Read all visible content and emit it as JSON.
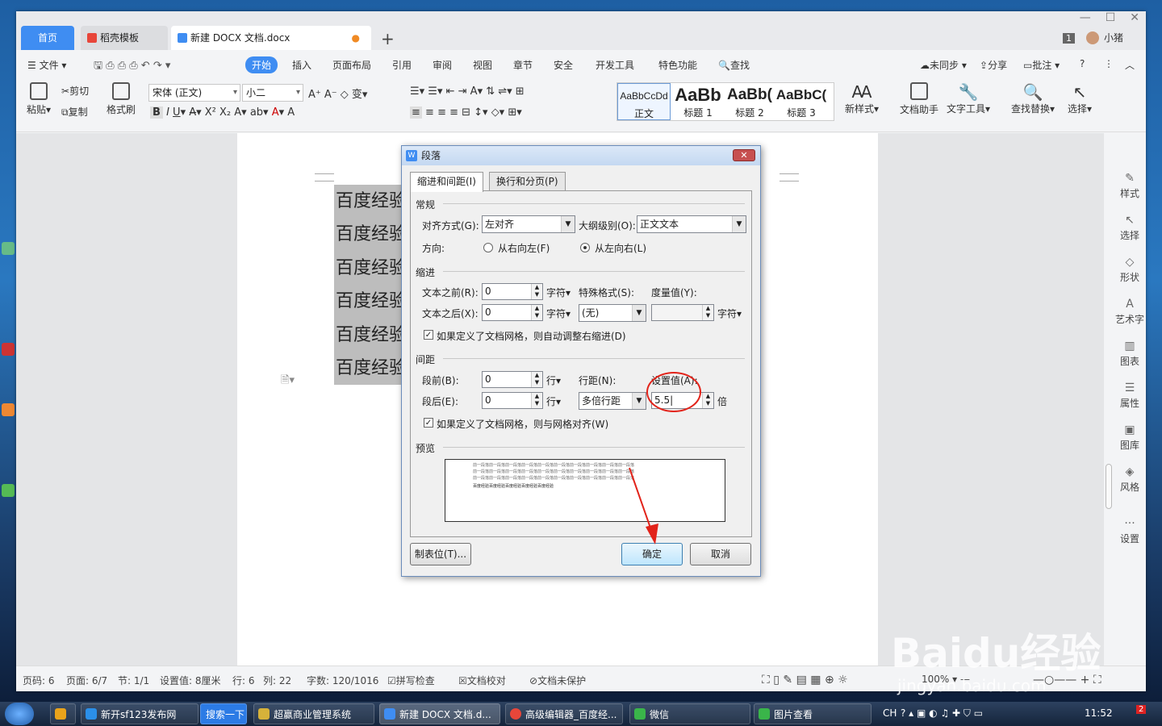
{
  "app": {
    "tabs": {
      "home": "首页",
      "template": "稻壳模板",
      "doc": "新建 DOCX 文档.docx"
    },
    "user": "小猪",
    "badge": "1"
  },
  "menu": {
    "file": "文件",
    "start": "开始",
    "insert": "插入",
    "layout": "页面布局",
    "ref": "引用",
    "review": "审阅",
    "view": "视图",
    "chapter": "章节",
    "security": "安全",
    "dev": "开发工具",
    "special": "特色功能",
    "search": "查找",
    "sync": "未同步",
    "share": "分享",
    "comment": "批注"
  },
  "ribbon": {
    "paste": "粘贴",
    "cut": "剪切",
    "copy": "复制",
    "painter": "格式刷",
    "font": "宋体 (正文)",
    "size": "小二",
    "doc_helper": "文档助手",
    "text_tool": "文字工具",
    "find_replace": "查找替换",
    "select": "选择",
    "new_style": "新样式",
    "styles": [
      {
        "sample": "AaBbCcDd",
        "label": "正文"
      },
      {
        "sample": "AaBb",
        "label": "标题 1"
      },
      {
        "sample": "AaBb(",
        "label": "标题 2"
      },
      {
        "sample": "AaBbC(",
        "label": "标题 3"
      }
    ]
  },
  "doc": {
    "lines": [
      "百度经验",
      "百度经验",
      "百度经验",
      "百度经验",
      "百度经验",
      "百度经验"
    ]
  },
  "right_panel": [
    "样式",
    "选择",
    "形状",
    "艺术字",
    "图表",
    "属性",
    "图库",
    "风格",
    "设置"
  ],
  "status": {
    "page_no": "页码: 6",
    "page": "页面: 6/7",
    "section": "节: 1/1",
    "setting": "设置值: 8厘米",
    "row": "行: 6",
    "col": "列: 22",
    "words": "字数: 120/1016",
    "spell": "拼写检查",
    "proof": "文档校对",
    "protect": "文档未保护",
    "zoom": "100%"
  },
  "dialog": {
    "title": "段落",
    "tab1": "缩进和间距(I)",
    "tab2": "换行和分页(P)",
    "general": "常规",
    "align_label": "对齐方式(G):",
    "align_value": "左对齐",
    "outline_label": "大纲级别(O):",
    "outline_value": "正文文本",
    "direction_label": "方向:",
    "rtl": "从右向左(F)",
    "ltr": "从左向右(L)",
    "indent": "缩进",
    "before_text": "文本之前(R):",
    "before_value": "0",
    "after_text": "文本之后(X):",
    "after_value": "0",
    "unit_char": "字符",
    "special_label": "特殊格式(S):",
    "special_value": "(无)",
    "measure_label": "度量值(Y):",
    "indent_grid": "如果定义了文档网格，则自动调整右缩进(D)",
    "spacing": "间距",
    "before_para": "段前(B):",
    "before_para_value": "0",
    "after_para": "段后(E):",
    "after_para_value": "0",
    "unit_line": "行",
    "line_label": "行距(N):",
    "line_value": "多倍行距",
    "setting_label": "设置值(A):",
    "setting_value": "5.5",
    "unit_times": "倍",
    "snap_grid": "如果定义了文档网格，则与网格对齐(W)",
    "preview": "预览",
    "preview_prev": "前一段落前一段落前一段落前一段落前一段落前一段落前一段落前一段落前一段落前一段落",
    "preview_cur": "百度经验百度经验百度经验百度经验百度经验",
    "tabs_btn": "制表位(T)...",
    "ok": "确定",
    "cancel": "取消"
  },
  "taskbar": {
    "items": [
      "新开sf123发布网",
      "搜索一下",
      "超赢商业管理系统",
      "新建 DOCX 文档.d...",
      "高级编辑器_百度经...",
      "微信",
      "图片查看"
    ],
    "lang": "CH",
    "time": "11:52",
    "notif": "2"
  },
  "watermark": {
    "logo": "Baidu经验",
    "url": "jingyan.baidu.com"
  }
}
